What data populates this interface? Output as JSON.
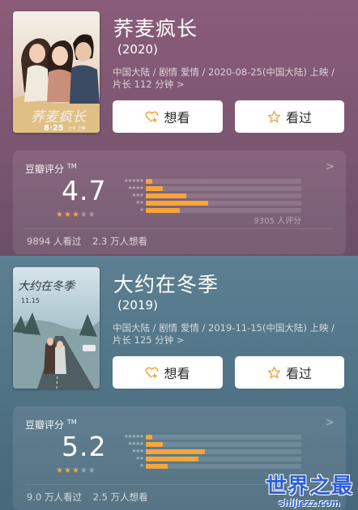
{
  "colors": {
    "section1_bg": "#7a5670",
    "section2_bg": "#4f7184",
    "bar_fill": "#f6a53a",
    "star_on": "#f4a73c",
    "watermark": "#2c5fd6"
  },
  "movies": [
    {
      "title": "荞麦疯长",
      "year": "(2020)",
      "meta_line1": "中国大陆 / 剧情 爱情 / 2020-08-25(中国大陆) 上映 /",
      "meta_line2": "片长 112 分钟 >",
      "poster": {
        "title_text": "荞麦疯长",
        "date_text": "8·25",
        "date_suffix": "七夕 上映"
      },
      "buttons": {
        "want": "想看",
        "seen": "看过"
      },
      "rating": {
        "label": "豆瓣评分",
        "tm": "TM",
        "arrow": ">",
        "score": "4.7",
        "stars_value": 2.5,
        "votes": "9305 人评分",
        "distribution": [
          {
            "stars": "★★★★★",
            "pct": 4
          },
          {
            "stars": "★★★★",
            "pct": 11
          },
          {
            "stars": "★★★",
            "pct": 26
          },
          {
            "stars": "★★",
            "pct": 40
          },
          {
            "stars": "★",
            "pct": 22
          }
        ],
        "watched": "9894 人看过",
        "want_to_watch": "2.3 万人想看"
      }
    },
    {
      "title": "大约在冬季",
      "year": "(2019)",
      "meta_line1": "中国大陆 / 剧情 爱情 / 2019-11-15(中国大陆) 上映 /",
      "meta_line2": "片长 125 分钟 >",
      "poster": {
        "title_text": "大约在冬季",
        "date_text": "11.15"
      },
      "buttons": {
        "want": "想看",
        "seen": "看过"
      },
      "rating": {
        "label": "豆瓣评分",
        "tm": "TM",
        "arrow": ">",
        "score": "5.2",
        "stars_value": 2.5,
        "votes": "",
        "distribution": [
          {
            "stars": "★★★★★",
            "pct": 4
          },
          {
            "stars": "★★★★",
            "pct": 11
          },
          {
            "stars": "★★★",
            "pct": 38
          },
          {
            "stars": "★★",
            "pct": 34
          },
          {
            "stars": "★",
            "pct": 14
          }
        ],
        "watched": "9.0 万人看过",
        "want_to_watch": "2.5 万人想看"
      }
    }
  ],
  "watermark": {
    "big": "世界之最",
    "small": "shijiezz.com"
  }
}
